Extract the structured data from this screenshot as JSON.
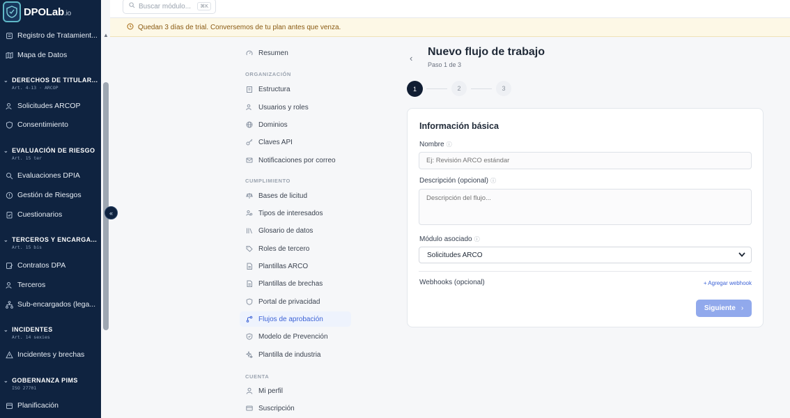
{
  "brand": {
    "name": "DPOLab",
    "suffix": ".io"
  },
  "search": {
    "placeholder": "Buscar módulo...",
    "shortcut": "⌘K"
  },
  "trial_banner": {
    "text": "Quedan 3 días de trial. Conversemos de tu plan antes que venza."
  },
  "sidebar": {
    "items_top": [
      {
        "label": "Registro de Tratamient...",
        "icon": "list-icon"
      },
      {
        "label": "Mapa de Datos",
        "icon": "map-icon"
      }
    ],
    "groups": [
      {
        "title": "DERECHOS DE TITULAR...",
        "sub": "Art. 4-13 · ARCOP",
        "items": [
          {
            "label": "Solicitudes ARCOP",
            "icon": "users-icon"
          },
          {
            "label": "Consentimiento",
            "icon": "shield-icon"
          }
        ]
      },
      {
        "title": "EVALUACIÓN DE RIESGO",
        "sub": "Art. 15 ter",
        "items": [
          {
            "label": "Evaluaciones DPIA",
            "icon": "search-icon"
          },
          {
            "label": "Gestión de Riesgos",
            "icon": "alert-circle-icon"
          },
          {
            "label": "Cuestionarios",
            "icon": "clipboard-icon"
          }
        ]
      },
      {
        "title": "TERCEROS Y ENCARGA...",
        "sub": "Art. 15 bis",
        "items": [
          {
            "label": "Contratos DPA",
            "icon": "contract-icon"
          },
          {
            "label": "Terceros",
            "icon": "users-icon"
          },
          {
            "label": "Sub-encargados (lega...",
            "icon": "network-icon"
          }
        ]
      },
      {
        "title": "INCIDENTES",
        "sub": "Art. 14 sexies",
        "items": [
          {
            "label": "Incidentes y brechas",
            "icon": "warning-icon"
          }
        ]
      },
      {
        "title": "GOBERNANZA PIMS",
        "sub": "ISO 27701",
        "items": [
          {
            "label": "Planificación",
            "icon": "calendar-icon"
          }
        ]
      }
    ]
  },
  "settings_nav": {
    "top_item": {
      "label": "Resumen",
      "icon": "gauge-icon"
    },
    "sections": [
      {
        "heading": "ORGANIZACIÓN",
        "items": [
          {
            "label": "Estructura",
            "icon": "building-icon"
          },
          {
            "label": "Usuarios y roles",
            "icon": "users-icon"
          },
          {
            "label": "Dominios",
            "icon": "globe-icon"
          },
          {
            "label": "Claves API",
            "icon": "key-icon"
          },
          {
            "label": "Notificaciones por correo",
            "icon": "mail-icon"
          }
        ]
      },
      {
        "heading": "CUMPLIMIENTO",
        "items": [
          {
            "label": "Bases de licitud",
            "icon": "scale-icon"
          },
          {
            "label": "Tipos de interesados",
            "icon": "user-group-icon"
          },
          {
            "label": "Glosario de datos",
            "icon": "library-icon"
          },
          {
            "label": "Roles de tercero",
            "icon": "tag-icon"
          },
          {
            "label": "Plantillas ARCO",
            "icon": "file-icon"
          },
          {
            "label": "Plantillas de brechas",
            "icon": "file-icon"
          },
          {
            "label": "Portal de privacidad",
            "icon": "shield-icon"
          },
          {
            "label": "Flujos de aprobación",
            "icon": "workflow-icon",
            "active": true
          },
          {
            "label": "Modelo de Prevención",
            "icon": "shield-check-icon"
          },
          {
            "label": "Plantilla de industria",
            "icon": "sparkle-icon"
          }
        ]
      },
      {
        "heading": "CUENTA",
        "items": [
          {
            "label": "Mi perfil",
            "icon": "user-icon"
          },
          {
            "label": "Suscripción",
            "icon": "credit-card-icon"
          }
        ]
      }
    ]
  },
  "page": {
    "title": "Nuevo flujo de trabajo",
    "subtitle": "Paso 1 de 3",
    "steps": [
      "1",
      "2",
      "3"
    ],
    "current_step": 1
  },
  "form": {
    "section_title": "Información básica",
    "name_label": "Nombre",
    "name_placeholder": "Ej: Revisión ARCO estándar",
    "desc_label": "Descripción (opcional)",
    "desc_placeholder": "Descripción del flujo...",
    "module_label": "Módulo asociado",
    "module_value": "Solicitudes ARCO",
    "webhooks_label": "Webhooks (opcional)",
    "add_webhook": "+ Agregar webhook",
    "next_label": "Siguiente"
  },
  "colors": {
    "sidebar_bg": "#0f2340",
    "accent": "#3d63d6",
    "button_disabled": "#91a9ec",
    "banner_bg": "#fdf8e6"
  }
}
